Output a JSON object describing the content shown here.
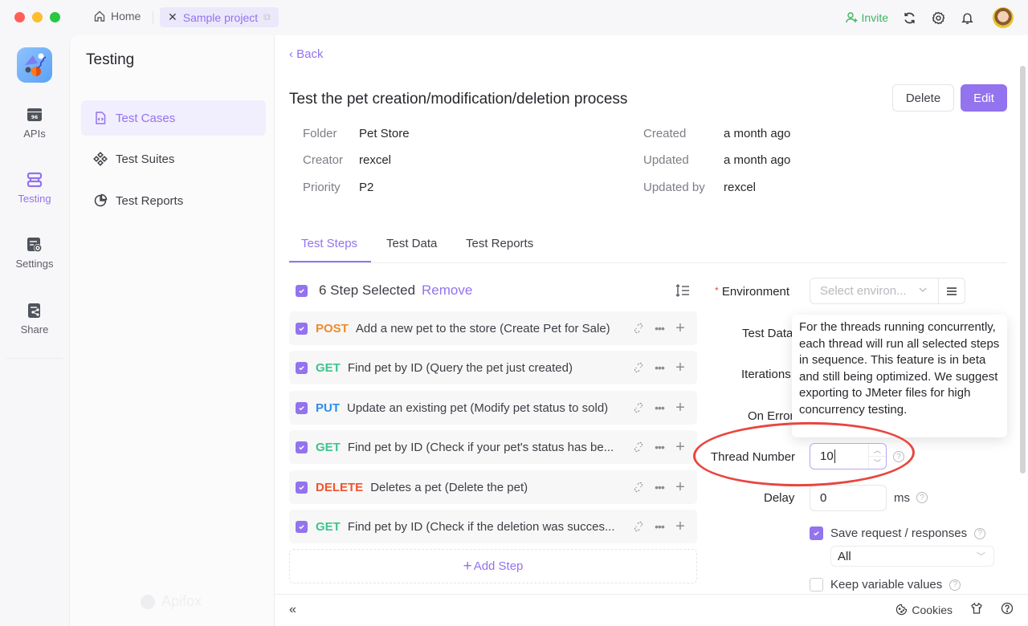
{
  "titlebar": {
    "home_label": "Home",
    "project_tab_label": "Sample project",
    "invite_label": "Invite"
  },
  "rail": {
    "items": [
      {
        "label": "APIs",
        "icon": "api-icon"
      },
      {
        "label": "Testing",
        "icon": "testing-icon",
        "active": true
      },
      {
        "label": "Settings",
        "icon": "settings-icon"
      },
      {
        "label": "Share",
        "icon": "share-icon"
      }
    ]
  },
  "panel": {
    "title": "Testing",
    "items": [
      {
        "label": "Test Cases",
        "icon": "test-case-file-icon",
        "active": true
      },
      {
        "label": "Test Suites",
        "icon": "test-suites-icon"
      },
      {
        "label": "Test Reports",
        "icon": "pie-chart-icon"
      }
    ],
    "watermark": "Apifox"
  },
  "main": {
    "back_label": "Back",
    "title": "Test the pet creation/modification/deletion process",
    "delete_label": "Delete",
    "edit_label": "Edit",
    "meta_left": [
      {
        "key": "Folder",
        "value": "Pet Store"
      },
      {
        "key": "Creator",
        "value": "rexcel"
      },
      {
        "key": "Priority",
        "value": "P2"
      }
    ],
    "meta_right": [
      {
        "key": "Created",
        "value": "a month ago"
      },
      {
        "key": "Updated",
        "value": "a month ago"
      },
      {
        "key": "Updated by",
        "value": "rexcel"
      }
    ],
    "tabs": [
      {
        "label": "Test Steps",
        "active": true
      },
      {
        "label": "Test Data"
      },
      {
        "label": "Test Reports"
      }
    ]
  },
  "steps": {
    "selected_label": "6 Step Selected",
    "remove_label": "Remove",
    "items": [
      {
        "method": "POST",
        "color": "#f08a2b",
        "name": "Add a new pet to the store (Create Pet for Sale)",
        "checked": true
      },
      {
        "method": "GET",
        "color": "#3cc58d",
        "name": "Find pet by ID (Query the pet just created)",
        "checked": true
      },
      {
        "method": "PUT",
        "color": "#2b8ff0",
        "name": "Update an existing pet (Modify pet status to sold)",
        "checked": true
      },
      {
        "method": "GET",
        "color": "#3cc58d",
        "name": "Find pet by ID (Check if your pet's status has be...",
        "checked": true
      },
      {
        "method": "DELETE",
        "color": "#f0542b",
        "name": "Deletes a pet (Delete the pet)",
        "checked": true
      },
      {
        "method": "GET",
        "color": "#3cc58d",
        "name": "Find pet by ID (Check if the deletion was succes...",
        "checked": true
      }
    ],
    "add_step_label": "Add Step"
  },
  "settings": {
    "environment_label": "Environment",
    "environment_placeholder": "Select environ...",
    "test_data_label": "Test Data",
    "iterations_label": "Iterations",
    "on_error_label": "On Error",
    "thread_number_label": "Thread Number",
    "thread_number_value": "10",
    "delay_label": "Delay",
    "delay_value": "0",
    "delay_unit": "ms",
    "save_label": "Save request / responses",
    "save_checked": true,
    "save_option": "All",
    "keep_label": "Keep variable values",
    "keep_checked": false,
    "tooltip": "For the threads running concurrently, each thread will run all selected steps in sequence. This feature is in beta and still being optimized. We suggest exporting to JMeter files for high concurrency testing."
  },
  "bottombar": {
    "cookies_label": "Cookies"
  },
  "colors": {
    "accent": "#9373ee",
    "highlight_ellipse": "#e8463f"
  }
}
